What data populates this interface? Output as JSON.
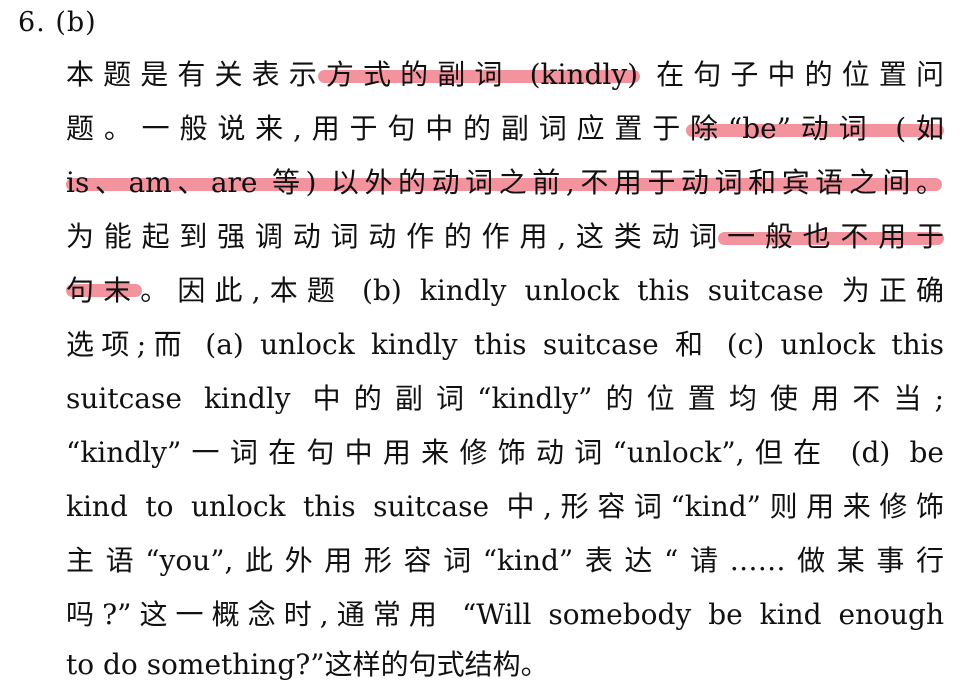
{
  "document": {
    "heading": "6. (b)",
    "lines": [
      "本题是有关表示方式的副词 (kindly) 在句子中的位置问",
      "题。一般说来,用于句中的副词应置于除“be”动词 (如",
      "is、am、are 等) 以外的动词之前,不用于动词和宾语之间。",
      "为能起到强调动词动作的作用,这类动词一般也不用于",
      "句末。因此,本题 (b) kindly unlock this suitcase 为正确",
      "选项;而 (a) unlock kindly this suitcase 和 (c) unlock this",
      "suitcase kindly 中的副词“kindly”的位置均使用不当;",
      "“kindly”一词在句中用来修饰动词“unlock”,但在 (d) be",
      "kind to unlock this suitcase 中,形容词“kind”则用来修饰",
      "主语“you”,此外用形容词“kind”表达“请……做某事行",
      "吗?”这一概念时,通常用 “Will somebody be kind enough",
      "to do something?”这样的句式结构。"
    ]
  },
  "colors": {
    "highlight": "#ee6f7e",
    "text": "#111111",
    "background": "#ffffff"
  }
}
